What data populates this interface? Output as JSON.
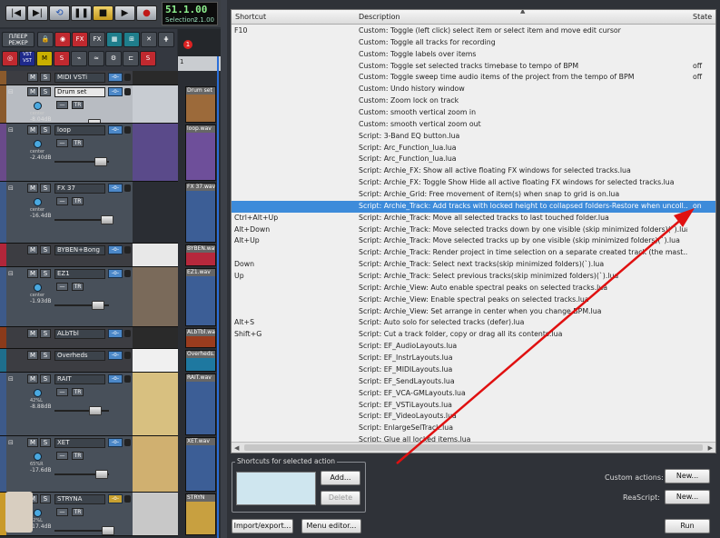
{
  "transport": {
    "time": "51.1.00",
    "selection_label": "Selection:",
    "selection_value": "2.1.00",
    "buttons": [
      "|◀",
      "▶|",
      "⟲",
      "❚❚",
      "■",
      "▶",
      "●"
    ]
  },
  "toolbar": {
    "row1": [
      "ПЛЕЕР РЕЖЕР",
      "",
      "",
      "FX",
      "FX",
      "",
      "",
      "",
      ""
    ],
    "row2": [
      "",
      "VST VST",
      "",
      "S",
      "",
      "",
      "",
      "",
      "S"
    ]
  },
  "arrange": {
    "marker": "1",
    "ruler": "1"
  },
  "tracks": [
    {
      "name": "MIDI VSTi",
      "folder": true,
      "num": "",
      "route": "-o-"
    },
    {
      "name": "Drum set",
      "num": "",
      "vol": "-8.04dB",
      "route": "-o-",
      "knob": "center",
      "selected": true
    },
    {
      "name": "loop",
      "num": "",
      "vol": "-2.40dB",
      "route": "-o-",
      "knob": "center"
    },
    {
      "name": "FX 37",
      "num": "",
      "vol": "-16.4dB",
      "route": "-o-",
      "knob": "center"
    },
    {
      "name": "BYBEN+Bong",
      "folder": true,
      "num": "",
      "route": "-o-"
    },
    {
      "name": "EZ1",
      "num": "",
      "vol": "-1.93dB",
      "route": "-o-",
      "knob": "center"
    },
    {
      "name": "ALbTbl",
      "folder": true,
      "num": "",
      "route": "-o-"
    },
    {
      "name": "Overheds",
      "folder": true,
      "num": "",
      "route": "-o-"
    },
    {
      "name": "RAIT",
      "num": "",
      "vol": "-8.88dB",
      "route": "-o-",
      "knob": "42%L"
    },
    {
      "name": "XET",
      "num": "",
      "vol": "-17.6dB",
      "route": "-o-",
      "knob": "65%R"
    },
    {
      "name": "STRYNA",
      "num": "",
      "vol": "-17.4dB",
      "route": "-o-",
      "knob": "42%L"
    }
  ],
  "items": [
    "Drum set",
    "loop.wav",
    "FX 37.wav",
    "BYBEN.wav",
    "EZ1.wav",
    "ALbTbl.wav",
    "Overheds.wav",
    "RAIT.wav",
    "XET.wav",
    "STRYN"
  ],
  "actions": {
    "columns": {
      "shortcut": "Shortcut",
      "description": "Description",
      "state": "State"
    },
    "rows": [
      {
        "shortcut": "F10",
        "description": "Custom: Toggle (left click) select item or select item and move edit cursor",
        "state": ""
      },
      {
        "shortcut": "",
        "description": "Custom: Toggle all tracks for recording",
        "state": ""
      },
      {
        "shortcut": "",
        "description": "Custom: Toggle labels over items",
        "state": ""
      },
      {
        "shortcut": "",
        "description": "Custom: Toggle set selected tracks timebase to tempo of BPM",
        "state": "off"
      },
      {
        "shortcut": "",
        "description": "Custom: Toggle sweep time audio items of the project from the tempo of BPM",
        "state": "off"
      },
      {
        "shortcut": "",
        "description": "Custom: Undo history window",
        "state": ""
      },
      {
        "shortcut": "",
        "description": "Custom: Zoom lock on track",
        "state": ""
      },
      {
        "shortcut": "",
        "description": "Custom: smooth vertical zoom in",
        "state": ""
      },
      {
        "shortcut": "",
        "description": "Custom: smooth vertical zoom out",
        "state": ""
      },
      {
        "shortcut": "",
        "description": "Script: 3-Band EQ button.lua",
        "state": ""
      },
      {
        "shortcut": "",
        "description": "Script: Arc_Function_lua.lua",
        "state": ""
      },
      {
        "shortcut": "",
        "description": "Script: Arc_Function_lua.lua",
        "state": ""
      },
      {
        "shortcut": "",
        "description": "Script: Archie_FX: Show all active floating FX windows for selected tracks.lua",
        "state": ""
      },
      {
        "shortcut": "",
        "description": "Script: Archie_FX: Toggle Show Hide all active floating FX windows for selected tracks.lua",
        "state": ""
      },
      {
        "shortcut": "",
        "description": "Script: Archie_Grid: Free movement of item(s) when snap to grid is on.lua",
        "state": ""
      },
      {
        "shortcut": "",
        "description": "Script: Archie_Track: Add tracks with locked height to collapsed folders-Restore when uncoll...",
        "state": "on",
        "selected": true
      },
      {
        "shortcut": "Ctrl+Alt+Up",
        "description": "Script: Archie_Track: Move all selected tracks to last touched folder.lua",
        "state": ""
      },
      {
        "shortcut": "Alt+Down",
        "description": "Script: Archie_Track: Move selected tracks down by one visible (skip minimized folders)(`).lua",
        "state": ""
      },
      {
        "shortcut": "Alt+Up",
        "description": "Script: Archie_Track: Move selected tracks up by one visible (skip minimized folders)(`).lua",
        "state": ""
      },
      {
        "shortcut": "",
        "description": "Script: Archie_Track: Render project in time selection on a separate created track (the mast...",
        "state": ""
      },
      {
        "shortcut": "Down",
        "description": "Script: Archie_Track: Select next tracks(skip minimized folders)(`).lua",
        "state": ""
      },
      {
        "shortcut": "Up",
        "description": "Script: Archie_Track: Select previous tracks(skip minimized folders)(`).lua",
        "state": ""
      },
      {
        "shortcut": "",
        "description": "Script: Archie_View: Auto enable spectral peaks on selected tracks.lua",
        "state": ""
      },
      {
        "shortcut": "",
        "description": "Script: Archie_View: Enable spectral peaks on selected tracks.lua",
        "state": ""
      },
      {
        "shortcut": "",
        "description": "Script: Archie_View: Set arrange in center when you change BPM.lua",
        "state": ""
      },
      {
        "shortcut": "Alt+S",
        "description": "Script: Auto solo for selected tracks (defer).lua",
        "state": ""
      },
      {
        "shortcut": "Shift+G",
        "description": "Script: Cut a track folder, copy or drag all its contents.lua",
        "state": ""
      },
      {
        "shortcut": "",
        "description": "Script: EF_AudioLayouts.lua",
        "state": ""
      },
      {
        "shortcut": "",
        "description": "Script: EF_InstrLayouts.lua",
        "state": ""
      },
      {
        "shortcut": "",
        "description": "Script: EF_MIDILayouts.lua",
        "state": ""
      },
      {
        "shortcut": "",
        "description": "Script: EF_SendLayouts.lua",
        "state": ""
      },
      {
        "shortcut": "",
        "description": "Script: EF_VCA-GMLayouts.lua",
        "state": ""
      },
      {
        "shortcut": "",
        "description": "Script: EF_VSTiLayouts.lua",
        "state": ""
      },
      {
        "shortcut": "",
        "description": "Script: EF_VideoLayouts.lua",
        "state": ""
      },
      {
        "shortcut": "",
        "description": "Script: EnlargeSelTrack.lua",
        "state": ""
      },
      {
        "shortcut": "",
        "description": "Script: Glue all locked items.lua",
        "state": ""
      }
    ]
  },
  "shortcuts_group": {
    "label": "Shortcuts for selected action",
    "add": "Add...",
    "delete": "Delete"
  },
  "custom_actions": {
    "label": "Custom actions:",
    "new": "New..."
  },
  "reascript": {
    "label": "ReaScript:",
    "new": "New..."
  },
  "footer": {
    "import_export": "Import/export...",
    "menu_editor": "Menu editor...",
    "run": "Run"
  },
  "colors": {
    "selection": "#3d8bda",
    "annotation_arrow": "#e01010"
  }
}
